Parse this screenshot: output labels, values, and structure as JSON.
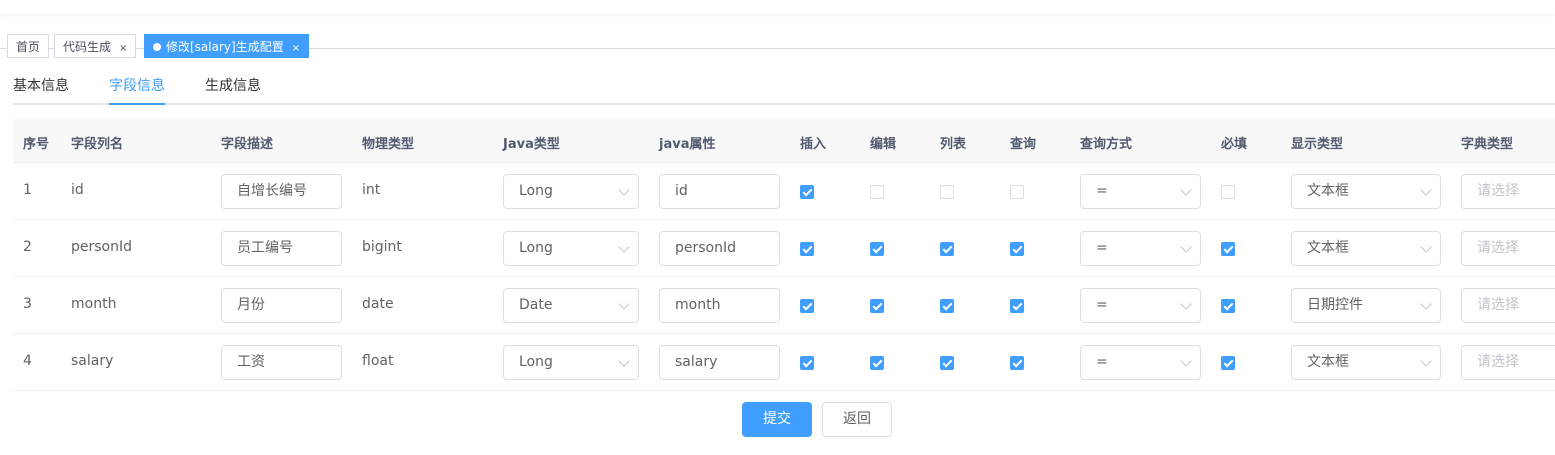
{
  "tags": [
    {
      "label": "首页",
      "active": false,
      "closable": false
    },
    {
      "label": "代码生成",
      "active": false,
      "closable": true
    },
    {
      "label": "修改[salary]生成配置",
      "active": true,
      "closable": true
    }
  ],
  "tabs": [
    "基本信息",
    "字段信息",
    "生成信息"
  ],
  "active_tab": 1,
  "columns": [
    "序号",
    "字段列名",
    "字段描述",
    "物理类型",
    "Java类型",
    "java属性",
    "插入",
    "编辑",
    "列表",
    "查询",
    "查询方式",
    "必填",
    "显示类型",
    "字典类型"
  ],
  "rows": [
    {
      "index": "1",
      "column": "id",
      "desc": "自增长编号",
      "physical": "int",
      "javaType": "Long",
      "javaField": "id",
      "insert": true,
      "edit": false,
      "list": false,
      "query": false,
      "queryType": "=",
      "required": false,
      "htmlType": "文本框",
      "dictType": "请选择"
    },
    {
      "index": "2",
      "column": "personId",
      "desc": "员工编号",
      "physical": "bigint",
      "javaType": "Long",
      "javaField": "personId",
      "insert": true,
      "edit": true,
      "list": true,
      "query": true,
      "queryType": "=",
      "required": true,
      "htmlType": "文本框",
      "dictType": "请选择"
    },
    {
      "index": "3",
      "column": "month",
      "desc": "月份",
      "physical": "date",
      "javaType": "Date",
      "javaField": "month",
      "insert": true,
      "edit": true,
      "list": true,
      "query": true,
      "queryType": "=",
      "required": true,
      "htmlType": "日期控件",
      "dictType": "请选择"
    },
    {
      "index": "4",
      "column": "salary",
      "desc": "工资",
      "physical": "float",
      "javaType": "Long",
      "javaField": "salary",
      "insert": true,
      "edit": true,
      "list": true,
      "query": true,
      "queryType": "=",
      "required": true,
      "htmlType": "文本框",
      "dictType": "请选择"
    }
  ],
  "buttons": {
    "submit": "提交",
    "back": "返回"
  },
  "colors": {
    "primary": "#409eff",
    "border": "#dcdfe6"
  }
}
